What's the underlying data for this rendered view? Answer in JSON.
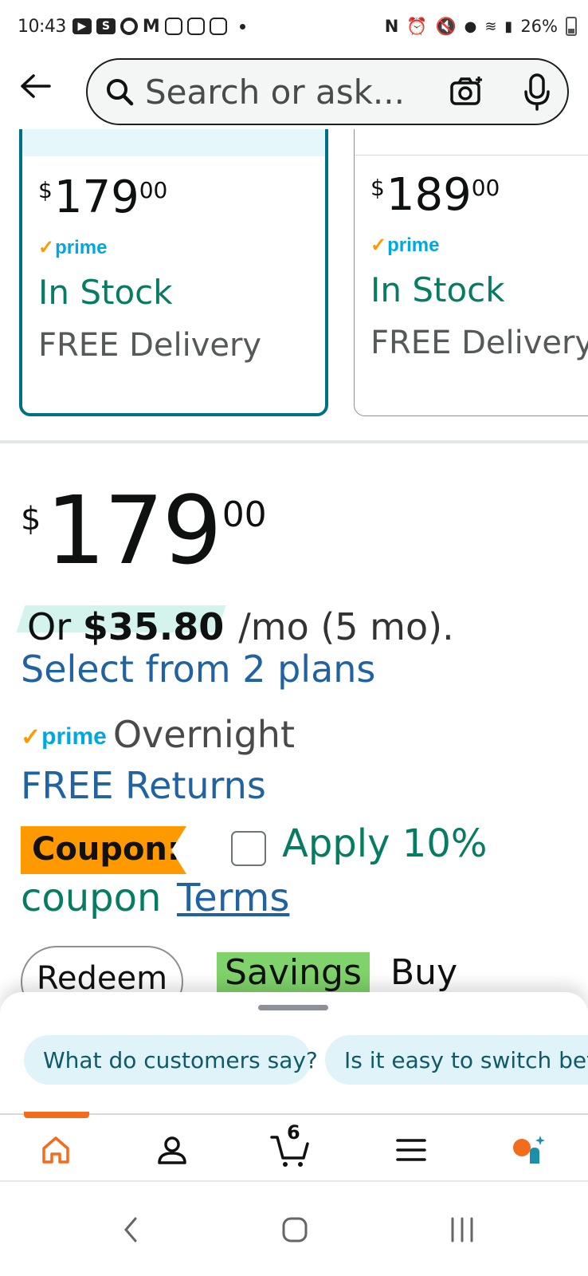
{
  "status_bar": {
    "time": "10:43",
    "s_badge": "S",
    "battery": "26%"
  },
  "search": {
    "placeholder": "Search or ask..."
  },
  "variants": [
    {
      "currency": "$",
      "whole": "179",
      "fraction": "00",
      "prime": "prime",
      "stock": "In Stock",
      "delivery": "FREE Delivery",
      "selected": true
    },
    {
      "currency": "$",
      "whole": "189",
      "fraction": "00",
      "prime": "prime",
      "stock": "In Stock",
      "delivery": "FREE Delivery",
      "selected": false
    }
  ],
  "price": {
    "currency": "$",
    "whole": "179",
    "fraction": "00"
  },
  "installment": {
    "or": "Or",
    "amount": "$35.80",
    "term": "/mo (5 mo).",
    "plans_link": "Select from 2 plans"
  },
  "delivery": {
    "prime": "prime",
    "speed": "Overnight",
    "returns_link": "FREE Returns"
  },
  "coupon": {
    "badge": "Coupon:",
    "apply_text": "Apply 10%",
    "line2": "coupon",
    "terms_link": "Terms",
    "checked": false
  },
  "peek": {
    "redeem": "Redeem",
    "savings": "Savings",
    "buy": "Buy"
  },
  "assistant_sheet": {
    "chips": [
      "What do customers say?",
      "Is it easy to switch betw"
    ]
  },
  "nav": {
    "items": [
      "home-icon",
      "account-icon",
      "cart-icon",
      "menu-icon",
      "rufus-icon"
    ],
    "active": "home",
    "cart_count": "6",
    "accent": "#f46c1b"
  },
  "colors": {
    "link": "#2162a1",
    "stock_green": "#067d62",
    "selected_border": "#007185",
    "coupon_orange": "#ff9900",
    "prime_blue": "#00a8e1"
  }
}
